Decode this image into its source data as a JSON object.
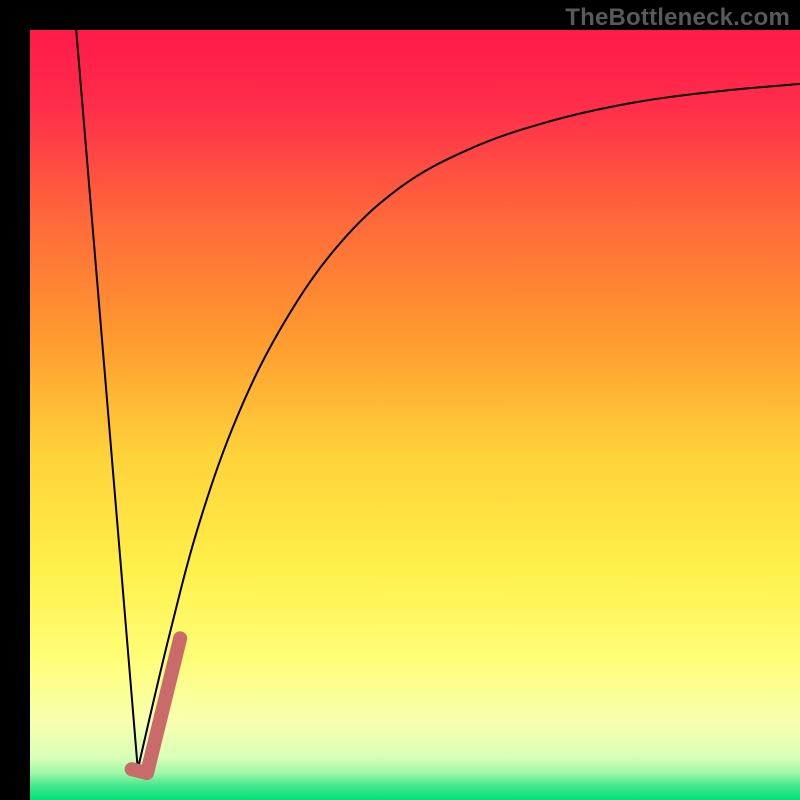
{
  "watermark": "TheBottleneck.com",
  "chart_data": {
    "type": "line",
    "title": "",
    "xlabel": "",
    "ylabel": "",
    "xlim": [
      0,
      100
    ],
    "ylim": [
      0,
      100
    ],
    "grid": false,
    "legend": false,
    "background_gradient": {
      "stops": [
        {
          "offset": 0.0,
          "color": "#ff1a4a"
        },
        {
          "offset": 0.1,
          "color": "#ff2d4a"
        },
        {
          "offset": 0.25,
          "color": "#ff6a3a"
        },
        {
          "offset": 0.4,
          "color": "#ff9a2f"
        },
        {
          "offset": 0.55,
          "color": "#ffd23a"
        },
        {
          "offset": 0.7,
          "color": "#fff04a"
        },
        {
          "offset": 0.82,
          "color": "#ffff7a"
        },
        {
          "offset": 0.9,
          "color": "#f8ffb0"
        },
        {
          "offset": 0.945,
          "color": "#d8ffb8"
        },
        {
          "offset": 0.965,
          "color": "#a0f8a8"
        },
        {
          "offset": 0.98,
          "color": "#4be890"
        },
        {
          "offset": 1.0,
          "color": "#00e076"
        }
      ]
    },
    "series": [
      {
        "name": "bottleneck-curve",
        "color": "#000000",
        "stroke_width": 2,
        "points": [
          {
            "x": 6.0,
            "y": 100.0
          },
          {
            "x": 14.0,
            "y": 4.0
          },
          {
            "x": 18.0,
            "y": 21.0
          },
          {
            "x": 22.0,
            "y": 36.0
          },
          {
            "x": 27.0,
            "y": 50.0
          },
          {
            "x": 33.0,
            "y": 62.0
          },
          {
            "x": 40.0,
            "y": 72.0
          },
          {
            "x": 48.0,
            "y": 79.5
          },
          {
            "x": 57.0,
            "y": 84.5
          },
          {
            "x": 67.0,
            "y": 88.0
          },
          {
            "x": 78.0,
            "y": 90.5
          },
          {
            "x": 89.0,
            "y": 92.0
          },
          {
            "x": 100.0,
            "y": 93.0
          }
        ]
      },
      {
        "name": "highlight-segment",
        "color": "#cb6a6b",
        "stroke_width": 14,
        "linecap": "round",
        "points": [
          {
            "x": 13.2,
            "y": 4.0
          },
          {
            "x": 15.2,
            "y": 3.5
          },
          {
            "x": 19.5,
            "y": 21.0
          }
        ]
      }
    ]
  }
}
